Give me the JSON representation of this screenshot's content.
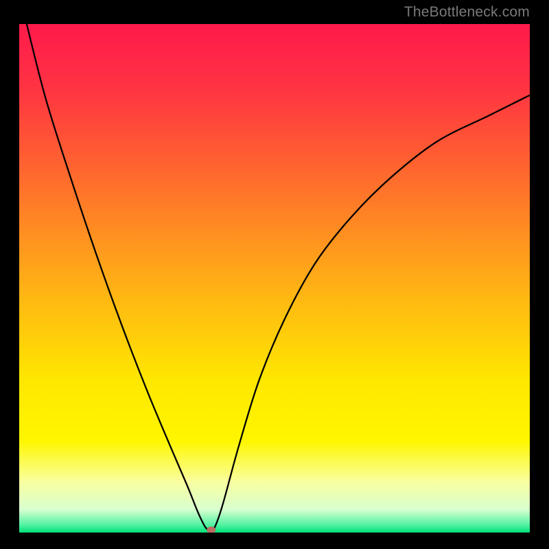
{
  "watermark": "TheBottleneck.com",
  "colors": {
    "black": "#000000",
    "curve": "#000000",
    "dot": "#bb6d62",
    "watermark": "#7a7a7a",
    "gradient_stops": [
      {
        "offset": 0.0,
        "hex": "#ff1a4b"
      },
      {
        "offset": 0.12,
        "hex": "#ff3243"
      },
      {
        "offset": 0.25,
        "hex": "#ff5a33"
      },
      {
        "offset": 0.4,
        "hex": "#ff8b22"
      },
      {
        "offset": 0.55,
        "hex": "#ffbb11"
      },
      {
        "offset": 0.7,
        "hex": "#ffe700"
      },
      {
        "offset": 0.82,
        "hex": "#fff600"
      },
      {
        "offset": 0.9,
        "hex": "#f9ffa0"
      },
      {
        "offset": 0.955,
        "hex": "#d7ffcf"
      },
      {
        "offset": 0.985,
        "hex": "#52f2a2"
      },
      {
        "offset": 1.0,
        "hex": "#00e27a"
      }
    ]
  },
  "chart_data": {
    "type": "line",
    "title": "",
    "xlabel": "",
    "ylabel": "",
    "xlim": [
      0,
      100
    ],
    "ylim": [
      0,
      100
    ],
    "grid": false,
    "legend": false,
    "series": [
      {
        "name": "bottleneck-curve",
        "x": [
          0.5,
          5,
          10,
          15,
          20,
          25,
          30,
          33,
          35,
          36.5,
          37.6,
          38.5,
          40,
          43,
          47,
          52,
          58,
          65,
          73,
          82,
          92,
          100
        ],
        "y": [
          104,
          86,
          70,
          55,
          41,
          28,
          16,
          9,
          4,
          1,
          0.3,
          1.5,
          6,
          17,
          30,
          42,
          53,
          62,
          70,
          77,
          82,
          86
        ]
      }
    ],
    "annotations": [
      {
        "name": "min-dot",
        "x": 37.6,
        "y": 0.5
      }
    ]
  }
}
